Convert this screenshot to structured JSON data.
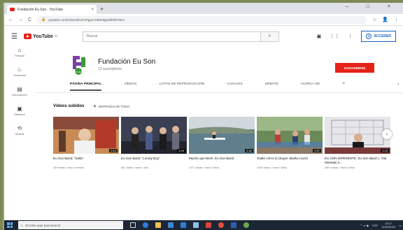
{
  "browser": {
    "tab_title": "Fundación Eu Son - YouTube",
    "tab_close": "×",
    "new_tab": "+",
    "window_controls": "– □ ×",
    "url": "youtube.com/channel/UCXPgu4-mkMHkgvwth0hl-Mx4",
    "back": "←",
    "forward": "→",
    "reload": "C",
    "lock": "🔒",
    "star": "☆",
    "profile": "👤",
    "menu": "⋮"
  },
  "youtube": {
    "logo": "YouTube",
    "logo_region": "ES",
    "search_placeholder": "Buscar",
    "search_icon": "⌕",
    "camera_icon": "▣",
    "apps_icon": "⋮⋮",
    "more_icon": "⋮",
    "sign_in": "ACCEDER"
  },
  "rail": [
    {
      "icon": "⌂",
      "label": "Principal"
    },
    {
      "icon": "♨",
      "label": "Tendencias"
    },
    {
      "icon": "▤",
      "label": "Suscripciones"
    },
    {
      "icon": "▣",
      "label": "Biblioteca"
    },
    {
      "icon": "⟲",
      "label": "Historial"
    }
  ],
  "channel": {
    "name": "Fundación Eu Son",
    "subscribers": "12 suscriptores",
    "subscribe": "SUSCRIBIRSE",
    "logo_text": "eu son"
  },
  "tabs": [
    "PÁGINA PRINCIPAL",
    "VÍDEOS",
    "LISTAS DE REPRODUCCIÓN",
    "CANALES",
    "DEBATE",
    "ACERCA DE"
  ],
  "tab_search_icon": "⌕",
  "tab_next": "›",
  "shelf": {
    "title": "Vídeos subidos",
    "play_all": "REPRODUCIR TODO",
    "play_icon": "▶"
  },
  "videos": [
    {
      "title": "Eu Son Band: \"Salta\"",
      "meta": "429 vistas • hace 9 meses",
      "duration": "2:13"
    },
    {
      "title": "Eu Son Band: \"Lonely Boy\"",
      "meta": "552 vistas • hace 1 año",
      "duration": "2:09"
    },
    {
      "title": "Mucho que Bech. Eu Son Band",
      "meta": "2127 vistas • hace 2 años",
      "duration": "2:32"
    },
    {
      "title": "Toalle cómo tú (Super Skaña cover)",
      "meta": "1009 vistas • hace 2 años",
      "duration": "3:37"
    },
    {
      "title": "EU SON DIFERENTE. Eu Son Band c. Trúr Montaini e...",
      "meta": "2867 vistas • hace 2 años",
      "duration": "2:23"
    }
  ],
  "next_arrow": "›",
  "taskbar": {
    "search": "Escribe aquí para buscar",
    "search_icon": "⌕",
    "time": "13:17",
    "date": "14/04/2020",
    "lang": "ESP"
  }
}
